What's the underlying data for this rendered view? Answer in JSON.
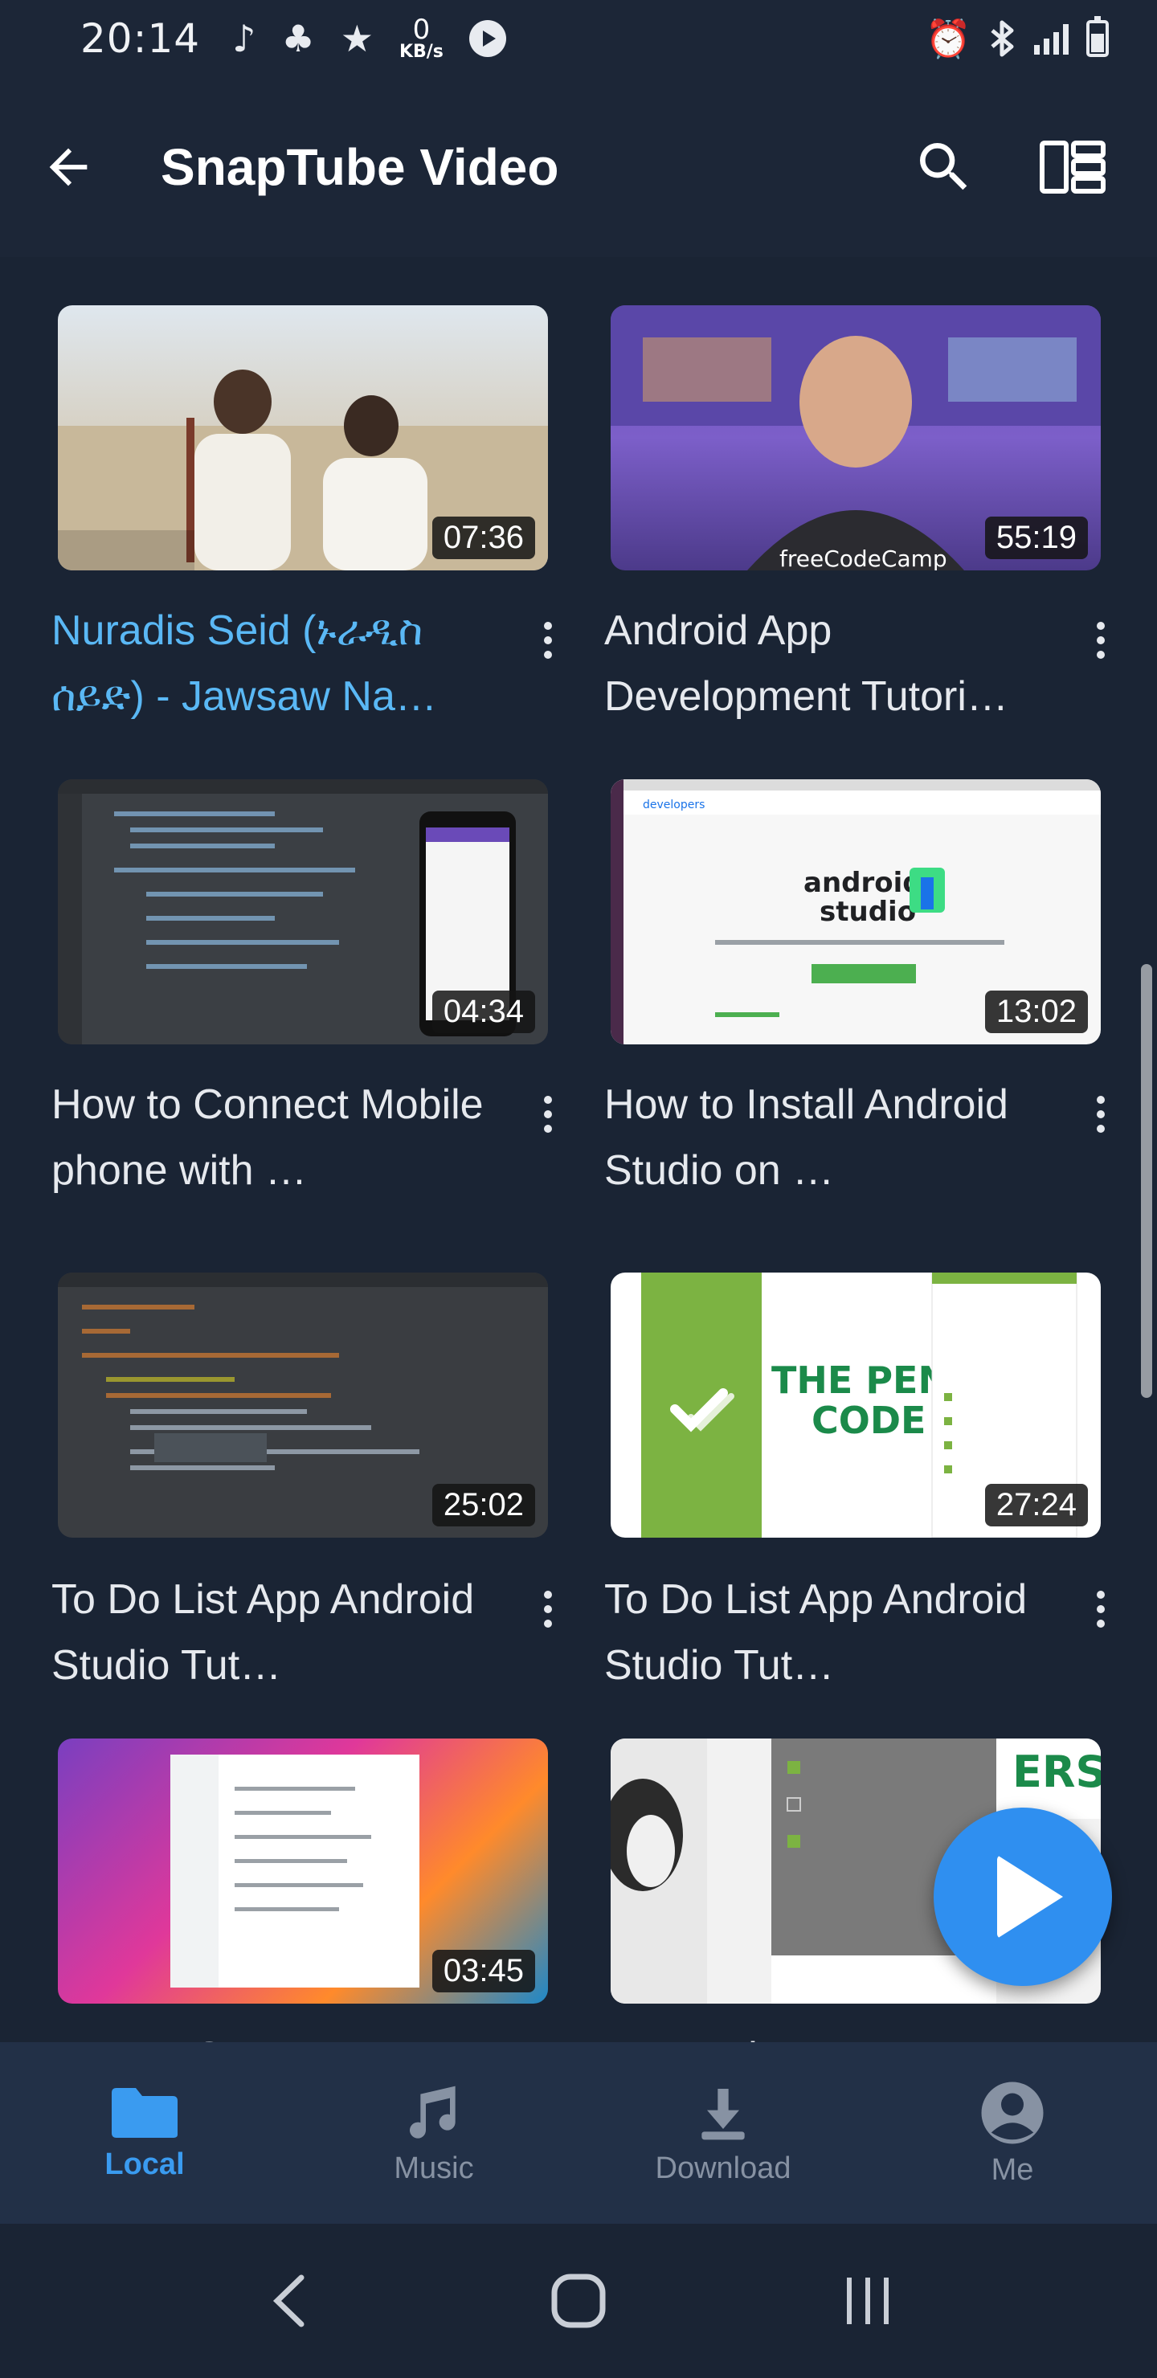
{
  "status_bar": {
    "time": "20:14",
    "net_speed": "0",
    "net_unit": "KB/s"
  },
  "toolbar": {
    "title": "SnapTube Video"
  },
  "videos": [
    {
      "title": "Nuradis Seid (ኑራዲስ ሰይድ)  - Jawsaw Na…",
      "duration": "07:36",
      "active": true
    },
    {
      "title": "Android App Development Tutori…",
      "duration": "55:19"
    },
    {
      "title": "How to Connect Mobile phone with …",
      "duration": "04:34"
    },
    {
      "title": "How to Install Android Studio on …",
      "duration": "13:02"
    },
    {
      "title": "To Do List App Android Studio Tut…",
      "duration": "25:02"
    },
    {
      "title": "To Do List App Android Studio Tut…",
      "duration": "27:24"
    },
    {
      "title": "How to Connect",
      "duration": "03:45"
    },
    {
      "title": "To Do List App",
      "duration": ""
    }
  ],
  "bottom_nav": {
    "items": [
      {
        "label": "Local",
        "icon": "folder-icon",
        "active": true
      },
      {
        "label": "Music",
        "icon": "music-note-icon"
      },
      {
        "label": "Download",
        "icon": "download-icon"
      },
      {
        "label": "Me",
        "icon": "account-icon"
      }
    ]
  },
  "colors": {
    "accent": "#3a9bf0",
    "background": "#1a2434",
    "fab": "#2f8ff0"
  }
}
